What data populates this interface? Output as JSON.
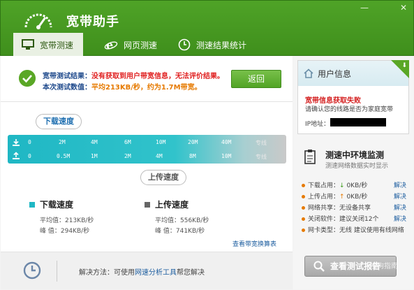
{
  "app": {
    "title": "宽带助手"
  },
  "window_controls": {
    "minimize": "—",
    "close": "✕"
  },
  "tabs": [
    {
      "label": "宽带测速",
      "icon": "monitor-icon",
      "active": true
    },
    {
      "label": "网页测速",
      "icon": "ie-icon",
      "active": false
    },
    {
      "label": "测速结果统计",
      "icon": "clock-icon",
      "active": false
    }
  ],
  "result": {
    "line1_label": "宽带测试结果：",
    "line1_value": "没有获取到用户带宽信息，无法评价结果。",
    "line2_label": "本次测试数值：",
    "line2_value": "平均213KB/秒，约为1.7M带宽。",
    "back_button": "返回"
  },
  "download_label": "下载速度",
  "upload_label": "上传速度",
  "scale": {
    "download_ticks": [
      "0",
      "2M",
      "4M",
      "6M",
      "10M",
      "20M",
      "40M",
      "专线"
    ],
    "upload_ticks": [
      "0",
      "0.5M",
      "1M",
      "2M",
      "4M",
      "8M",
      "10M",
      "专线"
    ]
  },
  "stats": {
    "download": {
      "title": "下载速度",
      "avg": "平均值：213KB/秒",
      "peak": "峰 值：294KB/秒",
      "color": "#1fb7c4"
    },
    "upload": {
      "title": "上传速度",
      "avg": "平均值：556KB/秒",
      "peak": "峰 值：741KB/秒",
      "color": "#666666"
    }
  },
  "view_link": "查看带宽换算表",
  "footer": {
    "prefix": "解决方法：可使用",
    "link": "网速分析工具",
    "suffix": "帮您解决"
  },
  "user_info": {
    "title": "用户信息",
    "fail": "宽带信息获取失败",
    "fail_sub": "请确认您的线路是否为家庭宽带",
    "ip_label": "IP地址："
  },
  "env": {
    "title": "测速中环境监测",
    "subtitle": "测速网络数据实时显示",
    "rows": [
      {
        "label": "下载占用：",
        "arrow": "↓",
        "value": "0KB/秒",
        "fix": "解决"
      },
      {
        "label": "上传占用：",
        "arrow": "↑",
        "value": "0KB/秒",
        "fix": "解决"
      },
      {
        "label": "网络共享：",
        "arrow": "",
        "value": "无设备共享",
        "fix": "解决"
      },
      {
        "label": "关闭软件：",
        "arrow": "",
        "value": "建议关闭12个",
        "fix": "解决"
      },
      {
        "label": "网卡类型：",
        "arrow": "",
        "value": "无线  建议使用有线网络",
        "fix": ""
      }
    ]
  },
  "report_button": "查看测试报告",
  "watermark": "搜狗指南"
}
